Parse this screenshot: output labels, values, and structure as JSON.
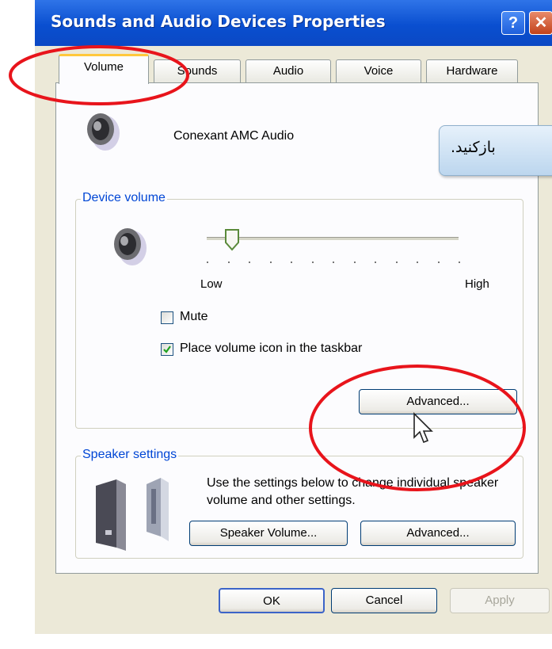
{
  "window": {
    "title": "Sounds and Audio Devices Properties",
    "help_label": "?",
    "close_label": "✕"
  },
  "tabs": [
    {
      "label": "Volume",
      "active": true
    },
    {
      "label": "Sounds",
      "active": false
    },
    {
      "label": "Audio",
      "active": false
    },
    {
      "label": "Voice",
      "active": false
    },
    {
      "label": "Hardware",
      "active": false
    }
  ],
  "device": {
    "name": "Conexant AMC Audio",
    "icon": "speaker-icon"
  },
  "device_volume": {
    "group_label": "Device volume",
    "low_label": "Low",
    "high_label": "High",
    "level_fraction": 0.1,
    "mute_label": "Mute",
    "mute_checked": false,
    "taskbar_label": "Place volume icon in the taskbar",
    "taskbar_checked": true,
    "advanced_label": "Advanced..."
  },
  "speaker_settings": {
    "group_label": "Speaker settings",
    "description": "Use the settings below to change individual speaker volume and other settings.",
    "speaker_volume_label": "Speaker Volume...",
    "advanced_label": "Advanced..."
  },
  "footer": {
    "ok_label": "OK",
    "cancel_label": "Cancel",
    "apply_label": "Apply"
  },
  "tooltip": {
    "text": "بازکنید."
  },
  "annotation_color": "#e8141b"
}
